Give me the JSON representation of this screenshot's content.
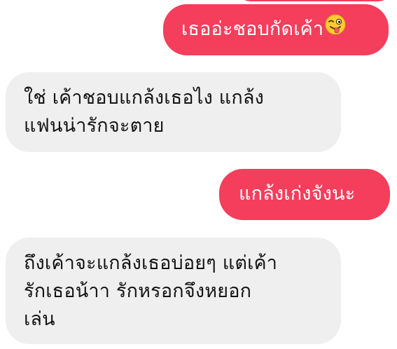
{
  "chat": {
    "colors": {
      "sent_bubble": "#f43e5c",
      "received_bubble": "#efefef",
      "sent_text": "#ffffff",
      "received_text": "#141414"
    },
    "messages": [
      {
        "direction": "sent",
        "lines": [
          "เธออ่ะชอบกัดเค้า"
        ],
        "emoji": "winking-face-with-tongue"
      },
      {
        "direction": "received",
        "lines": [
          "ใช่ เค้าชอบแกล้งเธอไง แกล้ง",
          "แฟนน่ารักจะตาย"
        ]
      },
      {
        "direction": "sent",
        "lines": [
          "แกล้งเก่งจังนะ"
        ]
      },
      {
        "direction": "received",
        "lines": [
          "ถึงเค้าจะแกล้งเธอบ่อยๆ แต่เค้า",
          "รักเธอน้าา รักหรอกจึงหยอก",
          "เล่น"
        ]
      }
    ]
  }
}
